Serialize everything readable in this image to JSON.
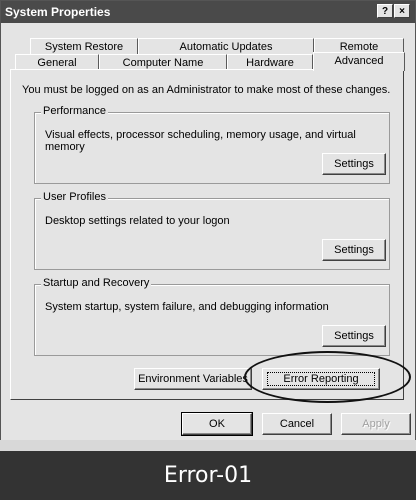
{
  "window": {
    "title": "System Properties",
    "help_button": "?",
    "close_button": "×"
  },
  "tabs": {
    "row1": [
      "System Restore",
      "Automatic Updates",
      "Remote"
    ],
    "row2": [
      "General",
      "Computer Name",
      "Hardware",
      "Advanced"
    ],
    "selected": "Advanced"
  },
  "intro_text": "You must be logged on as an Administrator to make most of these changes.",
  "groups": {
    "performance": {
      "title": "Performance",
      "description": "Visual effects, processor scheduling, memory usage, and virtual memory",
      "button": "Settings"
    },
    "user_profiles": {
      "title": "User Profiles",
      "description": "Desktop settings related to your logon",
      "button": "Settings"
    },
    "startup_recovery": {
      "title": "Startup and Recovery",
      "description": "System startup, system failure, and debugging information",
      "button": "Settings"
    }
  },
  "buttons": {
    "environment_variables": "Environment Variables",
    "error_reporting": "Error Reporting",
    "ok": "OK",
    "cancel": "Cancel",
    "apply": "Apply"
  },
  "caption": "Error-01",
  "colors": {
    "title_bar": "#4a4a4a",
    "dialog_face": "#e4e4e4",
    "caption_bar": "#333333",
    "highlight_ellipse": "#111111"
  }
}
